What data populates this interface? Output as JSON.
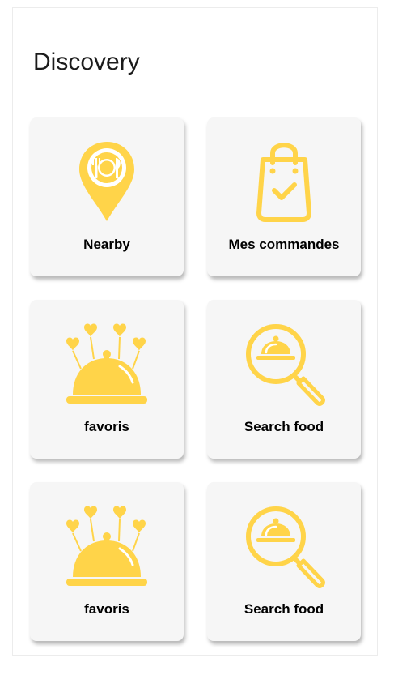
{
  "header": {
    "title": "Discovery"
  },
  "accent_color": "#FFD449",
  "cards": [
    {
      "label": "Nearby",
      "icon": "location-pin-plate-icon"
    },
    {
      "label": "Mes commandes",
      "icon": "shopping-bag-check-icon"
    },
    {
      "label": "favoris",
      "icon": "cloche-hearts-icon"
    },
    {
      "label": "Search food",
      "icon": "search-cloche-icon"
    },
    {
      "label": "favoris",
      "icon": "cloche-hearts-icon"
    },
    {
      "label": "Search food",
      "icon": "search-cloche-icon"
    }
  ]
}
